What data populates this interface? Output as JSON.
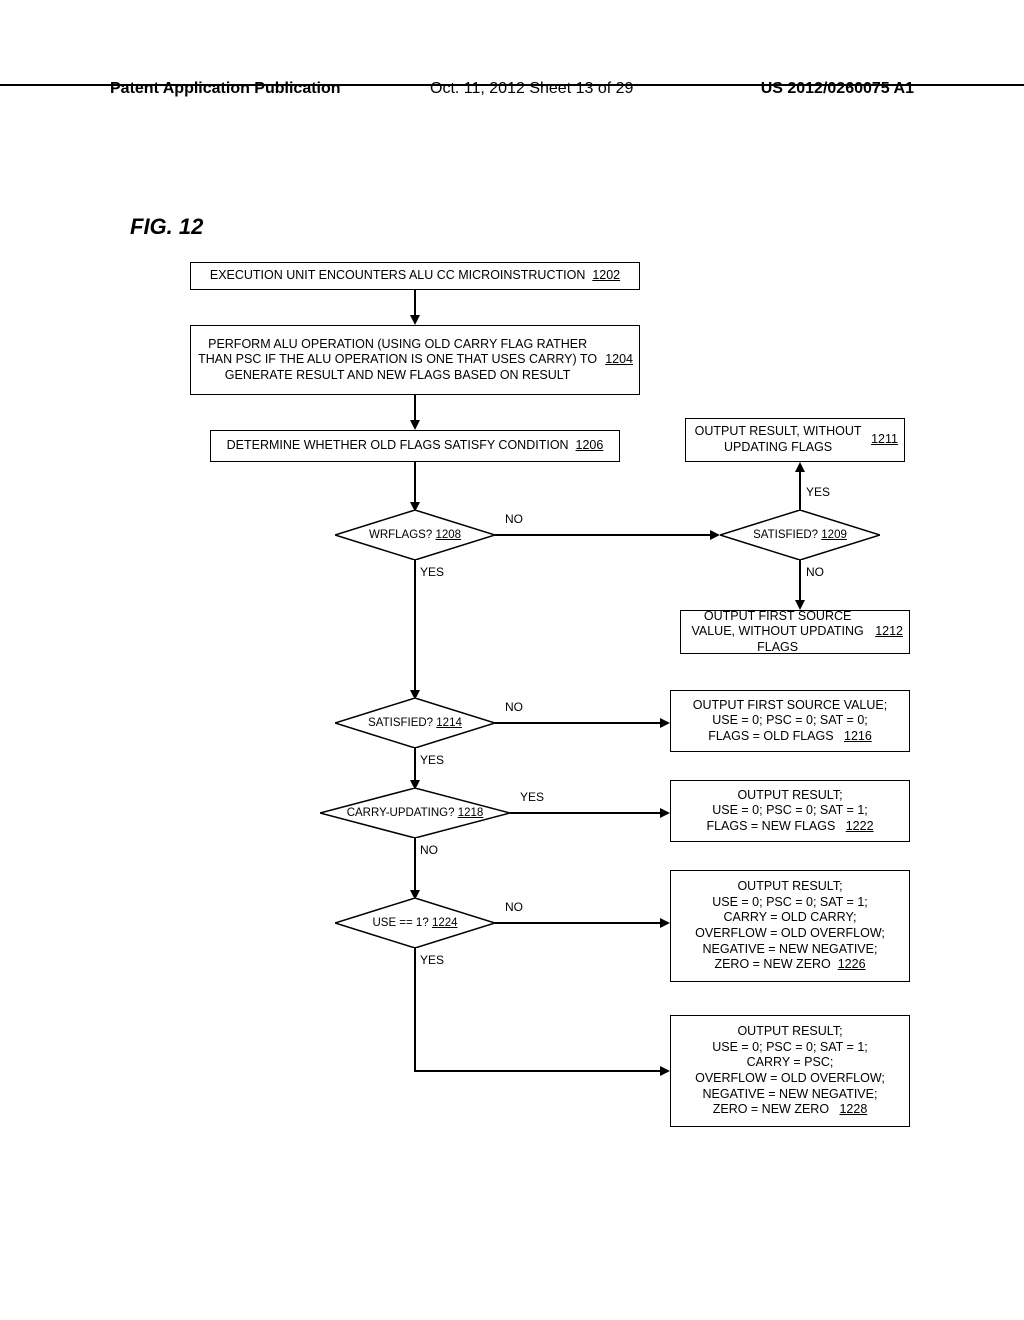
{
  "header": {
    "left": "Patent Application Publication",
    "mid": "Oct. 11, 2012  Sheet 13 of 29",
    "right": "US 2012/0260075 A1"
  },
  "figure_label": "FIG. 12",
  "boxes": {
    "b1202_text": "EXECUTION UNIT ENCOUNTERS ALU CC MICROINSTRUCTION",
    "b1202_ref": "1202",
    "b1204_text": "PERFORM ALU OPERATION (USING OLD CARRY FLAG RATHER THAN PSC IF THE ALU OPERATION IS ONE THAT USES CARRY) TO GENERATE RESULT AND NEW FLAGS BASED ON RESULT",
    "b1204_ref": "1204",
    "b1206_text": "DETERMINE WHETHER OLD FLAGS SATISFY CONDITION",
    "b1206_ref": "1206",
    "b1211_text": "OUTPUT RESULT, WITHOUT UPDATING FLAGS",
    "b1211_ref": "1211",
    "b1212_text": "OUTPUT FIRST SOURCE VALUE, WITHOUT UPDATING FLAGS",
    "b1212_ref": "1212",
    "b1216_l1": "OUTPUT FIRST SOURCE VALUE;",
    "b1216_l2": "USE = 0; PSC = 0; SAT = 0;",
    "b1216_l3": "FLAGS = OLD FLAGS",
    "b1216_ref": "1216",
    "b1222_l1": "OUTPUT RESULT;",
    "b1222_l2": "USE = 0; PSC = 0; SAT = 1;",
    "b1222_l3": "FLAGS = NEW FLAGS",
    "b1222_ref": "1222",
    "b1226_l1": "OUTPUT RESULT;",
    "b1226_l2": "USE = 0; PSC = 0; SAT = 1;",
    "b1226_l3": "CARRY = OLD CARRY;",
    "b1226_l4": "OVERFLOW = OLD OVERFLOW;",
    "b1226_l5": "NEGATIVE = NEW NEGATIVE;",
    "b1226_l6": "ZERO = NEW ZERO",
    "b1226_ref": "1226",
    "b1228_l1": "OUTPUT RESULT;",
    "b1228_l2": "USE = 0; PSC = 0; SAT = 1;",
    "b1228_l3": "CARRY = PSC;",
    "b1228_l4": "OVERFLOW = OLD OVERFLOW;",
    "b1228_l5": "NEGATIVE = NEW NEGATIVE;",
    "b1228_l6": "ZERO = NEW ZERO",
    "b1228_ref": "1228"
  },
  "decisions": {
    "d1208_text": "WRFLAGS?",
    "d1208_ref": "1208",
    "d1209_text": "SATISFIED?",
    "d1209_ref": "1209",
    "d1214_text": "SATISFIED?",
    "d1214_ref": "1214",
    "d1218_text": "CARRY-UPDATING?",
    "d1218_ref": "1218",
    "d1224_text": "USE == 1?",
    "d1224_ref": "1224"
  },
  "labels": {
    "yes": "YES",
    "no": "NO"
  }
}
